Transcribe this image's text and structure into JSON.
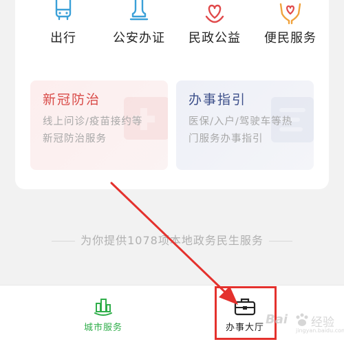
{
  "services": [
    {
      "label": "出行",
      "icon": "bus-icon"
    },
    {
      "label": "公安办证",
      "icon": "police-stamp-icon"
    },
    {
      "label": "民政公益",
      "icon": "heart-flower-icon"
    },
    {
      "label": "便民服务",
      "icon": "hands-heart-icon"
    }
  ],
  "cards": {
    "covid": {
      "title": "新冠防治",
      "desc": "线上问诊/疫苗接约等新冠防治服务"
    },
    "guide": {
      "title": "办事指引",
      "desc": "医保/入户/驾驶车等热门服务办事指引"
    }
  },
  "footer_text": "为你提供1078项本地政务民生服务",
  "tabbar": {
    "city_label": "城市服务",
    "hall_label": "办事大厅"
  },
  "watermark": {
    "brand": "Bai",
    "jingyan": "经验",
    "sub": "jingyan.baidu.com"
  },
  "colors": {
    "accent_green": "#2fae4a",
    "highlight_red": "#e4312d",
    "covid_red": "#d94b48",
    "guide_navy": "#3c4f8a"
  }
}
